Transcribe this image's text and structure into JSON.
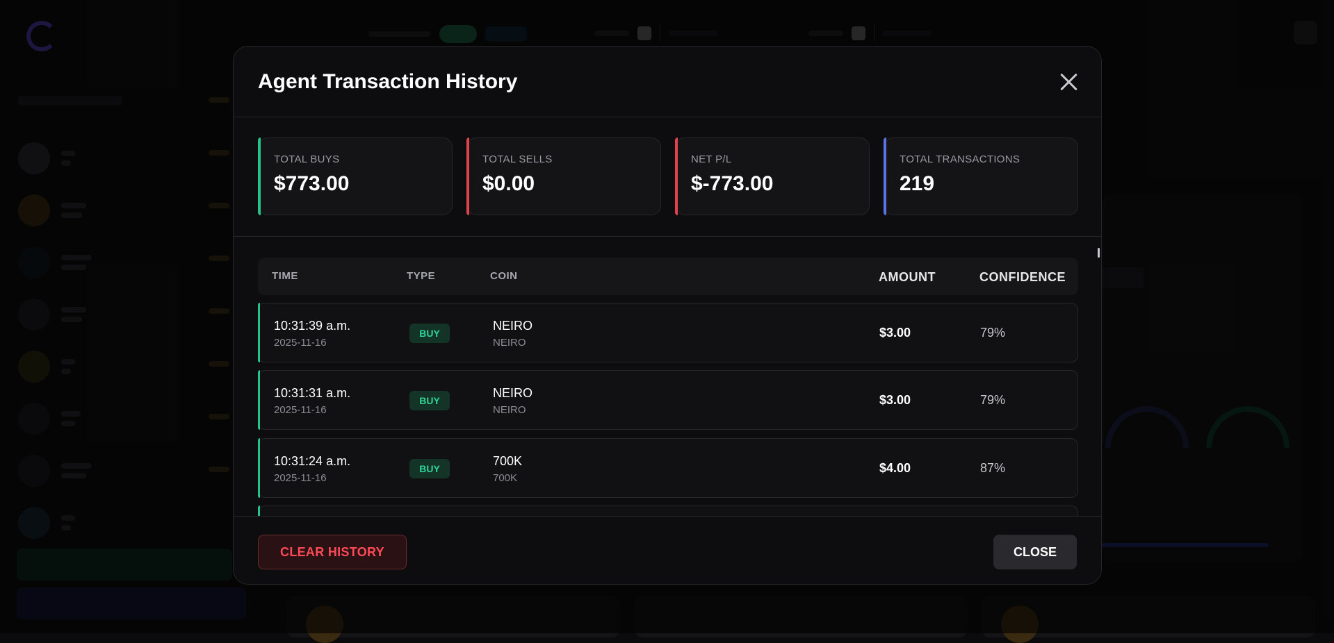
{
  "modal": {
    "title": "Agent Transaction History",
    "close_icon": "close-icon"
  },
  "stats": [
    {
      "label": "TOTAL BUYS",
      "value": "$773.00",
      "accent": "#25c28a"
    },
    {
      "label": "TOTAL SELLS",
      "value": "$0.00",
      "accent": "#e0434f"
    },
    {
      "label": "NET P/L",
      "value": "$-773.00",
      "accent": "#e0434f"
    },
    {
      "label": "TOTAL TRANSACTIONS",
      "value": "219",
      "accent": "#5a74e6"
    }
  ],
  "table": {
    "headers": {
      "time": "TIME",
      "type": "TYPE",
      "coin": "COIN",
      "amount": "AMOUNT",
      "confidence": "CONFIDENCE"
    },
    "rows": [
      {
        "time": "10:31:39 a.m.",
        "date": "2025-11-16",
        "type": "BUY",
        "coin": "NEIRO",
        "symbol": "NEIRO",
        "amount": "$3.00",
        "confidence": "79%"
      },
      {
        "time": "10:31:31 a.m.",
        "date": "2025-11-16",
        "type": "BUY",
        "coin": "NEIRO",
        "symbol": "NEIRO",
        "amount": "$3.00",
        "confidence": "79%"
      },
      {
        "time": "10:31:24 a.m.",
        "date": "2025-11-16",
        "type": "BUY",
        "coin": "700K",
        "symbol": "700K",
        "amount": "$4.00",
        "confidence": "87%"
      }
    ]
  },
  "footer": {
    "clear_label": "CLEAR HISTORY",
    "close_label": "CLOSE"
  },
  "colors": {
    "buy_accent": "#25c28a",
    "danger": "#ff4a57",
    "info": "#5a74e6",
    "modal_bg": "#0d0d0f"
  }
}
